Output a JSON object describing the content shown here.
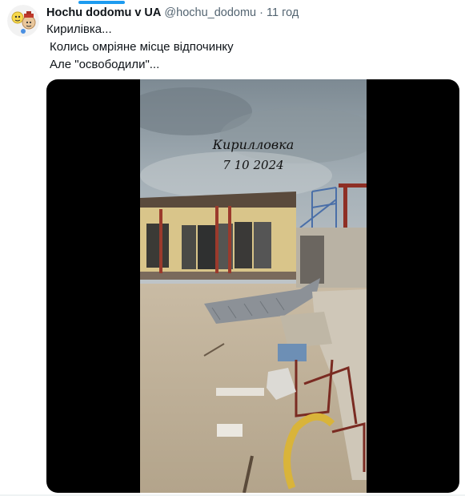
{
  "author": {
    "name": "Hochu dodomu v UA",
    "handle": "@hochu_dodomu",
    "separator": "·",
    "time": "11 год"
  },
  "tweet": {
    "lines": [
      "Кирилівка...",
      "Колись омріяне  місце відпочинку",
      "Але \"освободили\"..."
    ]
  },
  "media": {
    "overlay_title": "Кирилловка",
    "overlay_date": "7 10 2024"
  },
  "colors": {
    "accent": "#1d9bf0",
    "text": "#0f1419",
    "secondary": "#536471",
    "media_bg": "#000000"
  }
}
